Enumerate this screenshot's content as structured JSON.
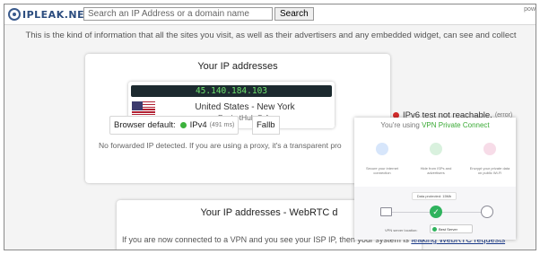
{
  "header": {
    "logo_text": "IPLEAK.NET",
    "search_placeholder": "Search an IP Address or a domain name",
    "search_button": "Search",
    "corner_text": "pow"
  },
  "intro": "This is the kind of information that all the sites you visit, as well as their advertisers and any embedded widget, can see and collect",
  "ip_panel": {
    "title": "Your IP addresses",
    "ip": "45.140.184.103",
    "location": "United States - New York",
    "isp": "PacketHub S.A.",
    "no_forward": "No forwarded IP detected. If you are using a proxy, it's a transparent pro",
    "browser_default_label": "Browser default:",
    "browser_default_proto": "IPv4",
    "browser_default_ms": "(491 ms)",
    "fallback_label": "Fallb",
    "ipv6_status": "IPv6 test not reachable.",
    "ipv6_error": "(error)"
  },
  "webrtc": {
    "title": "Your IP addresses - WebRTC d",
    "text": "If you are now connected to a VPN and you see your ISP IP, then your system is ",
    "link": "leaking WebRTC requests"
  },
  "ad": {
    "headline_prefix": "You're using ",
    "headline_accent": "VPN Private Connect",
    "features": [
      "Secure your internet connection",
      "Hide from ISPs and advertisers",
      "Encrypt your private data on public Wi-Fi"
    ],
    "protected": "Data protected: 15Mb",
    "server_label": "VPN server location:",
    "server_value": "Best Server"
  },
  "colors": {
    "ip_text": "#6fe36f",
    "ip_background": "#1c2a2f",
    "status_ok": "#3cb23c",
    "status_error": "#d22b2b",
    "ad_accent": "#3aaa35",
    "link": "#1a3a8a"
  }
}
